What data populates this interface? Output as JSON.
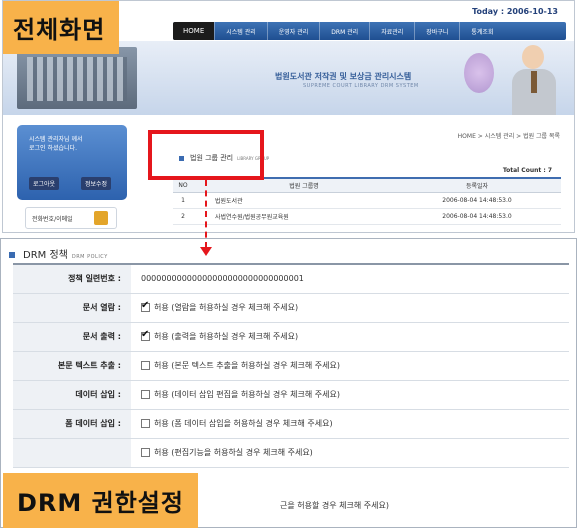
{
  "overlay": {
    "top_label": "전체화면",
    "bottom_label": "DRM 권한설정"
  },
  "top": {
    "today": "Today : 2006-10-13",
    "nav": {
      "home": "HOME",
      "items": [
        "시스템 관리",
        "운영자 관리",
        "DRM 관리",
        "자료관리",
        "장바구니",
        "통계조회"
      ]
    },
    "banner": {
      "title": "법원도서관 저작권 및 보상금 관리시스템",
      "subtitle": "SUPREME COURT LIBRARY DRM SYSTEM"
    },
    "sidebar": {
      "text_line1": "시스템 관리자님 께서",
      "text_line2": "로그인 하셨습니다.",
      "logout": "로그아웃",
      "info_edit": "정보수정",
      "card_label": "전화번호/이메일"
    },
    "breadcrumb": "HOME > 시스템 관리 > 법원 그룹 목록",
    "page_title": "법원 그룹 관리",
    "page_title_en": "LIBRARY GROUP",
    "total_count": "Total Count : 7",
    "table": {
      "headers": [
        "NO",
        "법원 그룹명",
        "등록일자"
      ],
      "rows": [
        [
          "1",
          "법원도서관",
          "2006-08-04 14:48:53.0"
        ],
        [
          "2",
          "사법연수원/법원공무원교육원",
          "2006-08-04 14:48:53.0"
        ]
      ]
    }
  },
  "bottom": {
    "title": "DRM 정책",
    "title_en": "DRM POLICY",
    "policy_id_label": "정책 일련번호 :",
    "policy_id": "00000000000000000000000000000001",
    "rows": [
      {
        "label": "문서 열람 :",
        "checked": true,
        "text": "허용 (열람을 허용하실 경우 체크해 주세요)"
      },
      {
        "label": "문서 출력 :",
        "checked": true,
        "text": "허용 (출력을 허용하실 경우 체크해 주세요)"
      },
      {
        "label": "본문 텍스트 추출 :",
        "checked": false,
        "text": "허용 (본문 텍스트 추출을 허용하실 경우 체크해 주세요)"
      },
      {
        "label": "데이터 삽입 :",
        "checked": false,
        "text": "허용 (데이터 삽입 편집을 허용하실 경우 체크해 주세요)"
      },
      {
        "label": "폼 데이터 삽입 :",
        "checked": false,
        "text": "허용 (폼 데이터 삽입을 허용하실 경우 체크해 주세요)"
      }
    ],
    "partial_row_text": "허용 (편집기능을 허용하실 경우 체크해 주세요)",
    "partial_row2_text": "근을 허용할 경우 체크해 주세요)"
  },
  "colors": {
    "highlight": "#e5161c",
    "label_bg": "#f8b24a",
    "nav_blue": "#2d62ae"
  }
}
